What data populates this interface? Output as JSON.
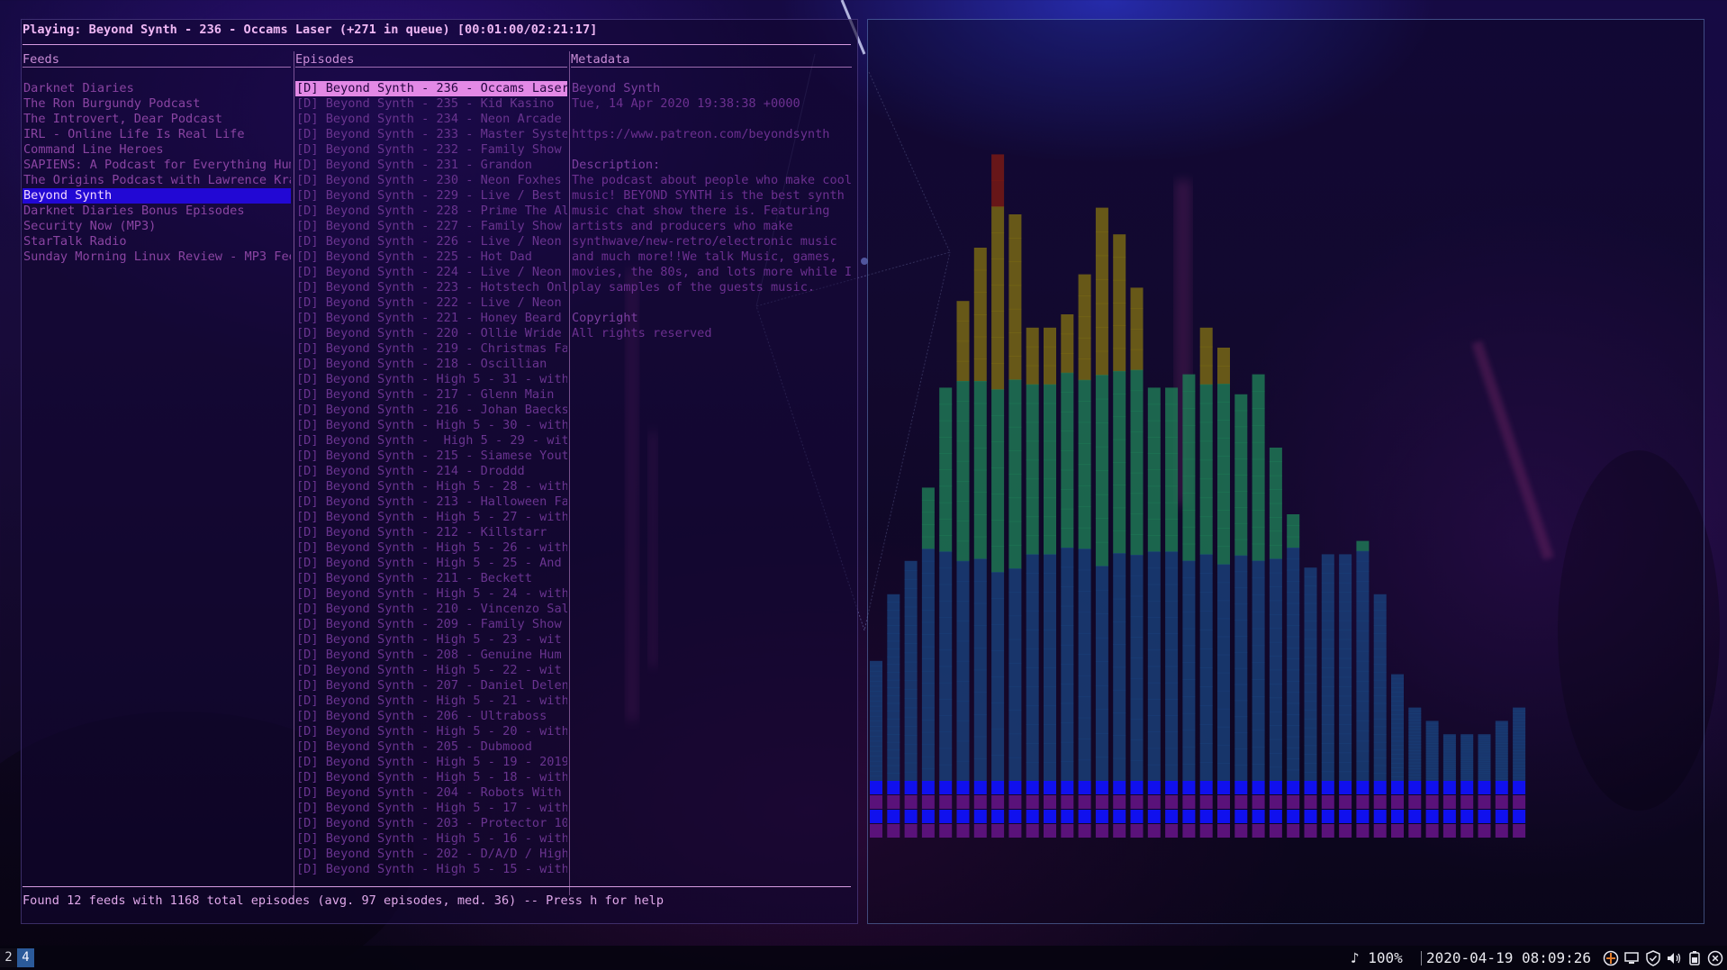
{
  "player": {
    "now_playing": "Playing: Beyond Synth - 236 - Occams Laser (+271 in queue) [00:01:00/02:21:17]"
  },
  "panes": {
    "feeds_title": "Feeds",
    "episodes_title": "Episodes",
    "metadata_title": "Metadata"
  },
  "feeds": [
    "Darknet Diaries",
    "The Ron Burgundy Podcast",
    "The Introvert, Dear Podcast",
    "IRL - Online Life Is Real Life",
    "Command Line Heroes",
    "SAPIENS: A Podcast for Everything Hum",
    "The Origins Podcast with Lawrence Kra",
    "Beyond Synth",
    "Darknet Diaries Bonus Episodes",
    "Security Now (MP3)",
    "StarTalk Radio",
    "Sunday Morning Linux Review - MP3 Fee"
  ],
  "selected_feed": 7,
  "episodes": [
    "[D] Beyond Synth - 236 - Occams Laser",
    "[D] Beyond Synth - 235 - Kid Kasino",
    "[D] Beyond Synth - 234 - Neon Arcade",
    "[D] Beyond Synth - 233 - Master Syste",
    "[D] Beyond Synth - 232 - Family Show",
    "[D] Beyond Synth - 231 - Grandon",
    "[D] Beyond Synth - 230 - Neon Foxhes",
    "[D] Beyond Synth - 229 - Live / Best",
    "[D] Beyond Synth - 228 - Prime The Al",
    "[D] Beyond Synth - 227 - Family Show",
    "[D] Beyond Synth - 226 - Live / Neon",
    "[D] Beyond Synth - 225 - Hot Dad",
    "[D] Beyond Synth - 224 - Live / Neon",
    "[D] Beyond Synth - 223 - Hotstech Onl",
    "[D] Beyond Synth - 222 - Live / Neon",
    "[D] Beyond Synth - 221 - Honey Beard",
    "[D] Beyond Synth - 220 - Ollie Wride",
    "[D] Beyond Synth - 219 - Christmas Fa",
    "[D] Beyond Synth - 218 - Oscillian",
    "[D] Beyond Synth - High 5 - 31 - with",
    "[D] Beyond Synth - 217 - Glenn Main",
    "[D] Beyond Synth - 216 - Johan Baecks",
    "[D] Beyond Synth - High 5 - 30 - with",
    "[D] Beyond Synth -  High 5 - 29 - wit",
    "[D] Beyond Synth - 215 - Siamese Yout",
    "[D] Beyond Synth - 214 - Droddd",
    "[D] Beyond Synth - High 5 - 28 - with",
    "[D] Beyond Synth - 213 - Halloween Fa",
    "[D] Beyond Synth - High 5 - 27 - with",
    "[D] Beyond Synth - 212 - Killstarr",
    "[D] Beyond Synth - High 5 - 26 - with",
    "[D] Beyond Synth - High 5 - 25 - And",
    "[D] Beyond Synth - 211 - Beckett",
    "[D] Beyond Synth - High 5 - 24 - with",
    "[D] Beyond Synth - 210 - Vincenzo Sal",
    "[D] Beyond Synth - 209 - Family Show",
    "[D] Beyond Synth - High 5 - 23 - wit",
    "[D] Beyond Synth - 208 - Genuine Hum",
    "[D] Beyond Synth - High 5 - 22 - wit",
    "[D] Beyond Synth - 207 - Daniel Delen",
    "[D] Beyond Synth - High 5 - 21 - with",
    "[D] Beyond Synth - 206 - Ultraboss",
    "[D] Beyond Synth - High 5 - 20 - with",
    "[D] Beyond Synth - 205 - Dubmood",
    "[D] Beyond Synth - High 5 - 19 - 2019",
    "[D] Beyond Synth - High 5 - 18 - with",
    "[D] Beyond Synth - 204 - Robots With",
    "[D] Beyond Synth - High 5 - 17 - with",
    "[D] Beyond Synth - 203 - Protector 10",
    "[D] Beyond Synth - High 5 - 16 - with",
    "[D] Beyond Synth - 202 - D/A/D / High",
    "[D] Beyond Synth - High 5 - 15 - with"
  ],
  "selected_episode": 0,
  "metadata": {
    "lines": [
      "Beyond Synth",
      "Tue, 14 Apr 2020 19:38:38 +0000",
      "",
      "https://www.patreon.com/beyondsynth",
      "",
      "Description:",
      "The podcast about people who make cool",
      "music! BEYOND SYNTH is the best synth",
      "music chat show there is. Featuring",
      "artists and producers who make",
      "synthwave/new-retro/electronic music",
      "and much more!!We talk Music, games,",
      "movies, the 80s, and lots more while I",
      "play samples of the guests music.",
      "",
      "Copyright",
      "All rights reserved"
    ]
  },
  "status": {
    "summary": "Found 12 feeds with 1168 total episodes (avg. 97 episodes, med. 36) -- Press h for help"
  },
  "visualizer": {
    "bar_levels": [
      0.18,
      0.28,
      0.33,
      0.44,
      0.59,
      0.72,
      0.8,
      0.94,
      0.85,
      0.68,
      0.68,
      0.7,
      0.76,
      0.86,
      0.82,
      0.74,
      0.59,
      0.59,
      0.61,
      0.68,
      0.65,
      0.58,
      0.61,
      0.5,
      0.4,
      0.32,
      0.34,
      0.34,
      0.36,
      0.28,
      0.16,
      0.11,
      0.09,
      0.07,
      0.07,
      0.07,
      0.09,
      0.11
    ],
    "colors": {
      "low": "#1a3f7a",
      "mid": "#1f7a55",
      "high": "#7a6a14",
      "peak": "#7a1a14",
      "base_blue": "#1010ee",
      "base_purple": "#5a127a"
    }
  },
  "taskbar": {
    "workspaces": [
      "2",
      "4"
    ],
    "active_workspace": "4",
    "volume": "♪ 100%",
    "datetime": "2020-04-19 08:09:26",
    "tray_icons": [
      "network-icon",
      "display-icon",
      "shield-icon",
      "speaker-icon",
      "battery-icon",
      "power-icon"
    ]
  }
}
